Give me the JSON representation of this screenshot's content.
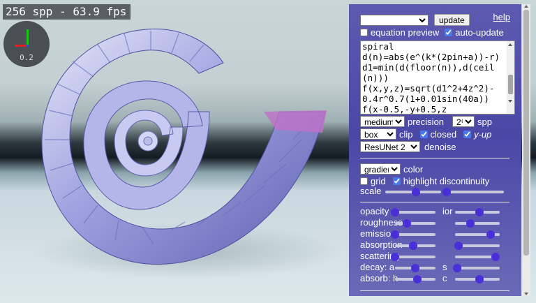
{
  "perf": {
    "text": "256 spp - 63.9 fps"
  },
  "gizmo": {
    "value": "0.2"
  },
  "panel": {
    "preset": {
      "selected": ""
    },
    "update_label": "update",
    "help_label": "help",
    "equation_preview": {
      "label": "equation preview",
      "checked": false
    },
    "auto_update": {
      "label": "auto-update",
      "checked": true
    },
    "equation_text": "spiral\nd(n)=abs(e^(k*(2pin+a))-r)\nd1=min(d(floor(n)),d(ceil\n(n)))\nf(x,y,z)=sqrt(d1^2+4z^2)-\n0.4r^0.7(1+0.01sin(40a))\nf(x-0.5,-y+0.5,z",
    "precision": {
      "selected": "medium",
      "label": "precision"
    },
    "spp": {
      "selected": "2⁸",
      "label": "spp"
    },
    "clip": {
      "selected": "box",
      "label": "clip"
    },
    "closed": {
      "label": "closed",
      "checked": true
    },
    "yup": {
      "label": "y-up",
      "checked": true
    },
    "denoise": {
      "selected": "ResUNet 2",
      "label": "denoise"
    },
    "color": {
      "selected": "gradient",
      "label": "color"
    },
    "grid": {
      "label": "grid",
      "checked": false
    },
    "highlight": {
      "label": "highlight discontinuity",
      "checked": true
    },
    "scale": {
      "label": "scale",
      "values": [
        0.55,
        0.0
      ]
    },
    "material": [
      {
        "label": "opacity",
        "value": 0.0,
        "label2": "ior",
        "value2": 0.55
      },
      {
        "label": "roughness",
        "value": 0.3,
        "value2": 0.35
      },
      {
        "label": "emission",
        "value": 0.0,
        "value2": 0.8
      },
      {
        "label": "absorption",
        "value": 0.45,
        "value2": 0.08
      },
      {
        "label": "scattering",
        "value": 0.0,
        "value2": 0.9
      },
      {
        "label": "decay: a",
        "value": 0.5,
        "label2": "s",
        "value2": 0.05
      },
      {
        "label": "absorb: h",
        "value": 0.55,
        "label2": "c",
        "value2": 0.55
      }
    ]
  }
}
